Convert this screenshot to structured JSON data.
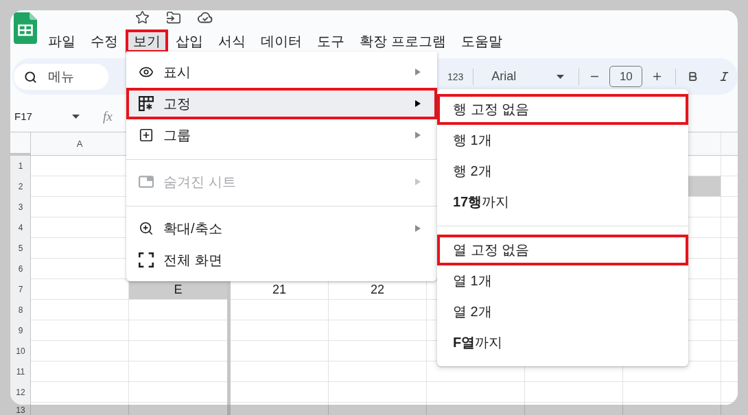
{
  "menu_bar": [
    {
      "label": "파일",
      "selected": false,
      "marked": false
    },
    {
      "label": "수정",
      "selected": false,
      "marked": false
    },
    {
      "label": "보기",
      "selected": true,
      "marked": true
    },
    {
      "label": "삽입",
      "selected": false,
      "marked": false
    },
    {
      "label": "서식",
      "selected": false,
      "marked": false
    },
    {
      "label": "데이터",
      "selected": false,
      "marked": false
    },
    {
      "label": "도구",
      "selected": false,
      "marked": false
    },
    {
      "label": "확장 프로그램",
      "selected": false,
      "marked": false
    },
    {
      "label": "도움말",
      "selected": false,
      "marked": false
    }
  ],
  "toolbar": {
    "search": {
      "placeholder": "메뉴"
    },
    "number_format": "123",
    "font": "Arial",
    "font_size": "10"
  },
  "formula_bar": {
    "cell_ref": "F17",
    "function_label": "fx"
  },
  "sheet": {
    "column_headers": [
      "A"
    ],
    "rows": [
      {
        "number": "1"
      },
      {
        "number": "2",
        "cells": [
          {
            "shaded": false
          },
          null,
          null,
          null,
          null,
          null,
          {
            "shaded": true
          }
        ]
      },
      {
        "number": "3"
      },
      {
        "number": "4"
      },
      {
        "number": "5"
      },
      {
        "number": "6"
      },
      {
        "number": "7",
        "cells": [
          {
            "shaded": false
          },
          {
            "text": "E",
            "shaded": true
          },
          {
            "text": "21",
            "shaded": false
          },
          {
            "text": "22",
            "shaded": false
          },
          {
            "shaded": false
          },
          null,
          {
            "shaded": false
          }
        ]
      },
      {
        "number": "8"
      },
      {
        "number": "9"
      },
      {
        "number": "10"
      },
      {
        "number": "11"
      },
      {
        "number": "12"
      }
    ],
    "dimmed_rows": [
      {
        "number": "13"
      }
    ]
  },
  "view_menu": {
    "items": [
      {
        "kind": "item",
        "label": "표시",
        "submenu": true,
        "selected": false,
        "disabled": false,
        "marked": false
      },
      {
        "kind": "item",
        "label": "고정",
        "submenu": true,
        "selected": true,
        "disabled": false,
        "marked": true
      },
      {
        "kind": "item",
        "label": "그룹",
        "submenu": true,
        "selected": false,
        "disabled": false,
        "marked": false
      },
      {
        "kind": "divider"
      },
      {
        "kind": "item",
        "label": "숨겨진 시트",
        "submenu": true,
        "selected": false,
        "disabled": true,
        "marked": false
      },
      {
        "kind": "divider"
      },
      {
        "kind": "item",
        "label": "확대/축소",
        "submenu": true,
        "selected": false,
        "disabled": false,
        "marked": false
      },
      {
        "kind": "item",
        "label": "전체 화면",
        "submenu": false,
        "selected": false,
        "disabled": false,
        "marked": false
      }
    ]
  },
  "freeze_submenu": {
    "items": [
      {
        "kind": "item",
        "label": "행 고정 없음",
        "marked": true
      },
      {
        "kind": "item",
        "label": "행 1개",
        "marked": false
      },
      {
        "kind": "item",
        "label": "행 2개",
        "marked": false
      },
      {
        "kind": "item",
        "label": "**17행**까지",
        "marked": false
      },
      {
        "kind": "divider"
      },
      {
        "kind": "item",
        "label": "열 고정 없음",
        "marked": true
      },
      {
        "kind": "item",
        "label": "열 1개",
        "marked": false
      },
      {
        "kind": "item",
        "label": "열 2개",
        "marked": false
      },
      {
        "kind": "item",
        "label": "**F열**까지",
        "marked": false
      }
    ]
  }
}
